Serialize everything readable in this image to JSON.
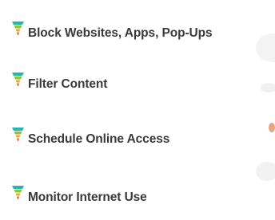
{
  "features": {
    "items": [
      {
        "label": "Block Websites, Apps, Pop-Ups",
        "icon": "filter-funnel-icon"
      },
      {
        "label": "Filter Content",
        "icon": "filter-funnel-icon"
      },
      {
        "label": "Schedule Online Access",
        "icon": "filter-funnel-icon"
      },
      {
        "label": "Monitor Internet Use",
        "icon": "filter-funnel-icon"
      }
    ]
  },
  "colors": {
    "text": "#3a3a3a",
    "icon_top": "#23b7b0",
    "icon_mid": "#8cc63f",
    "icon_bottom": "#f5a623",
    "icon_tip": "#e85d2c"
  }
}
